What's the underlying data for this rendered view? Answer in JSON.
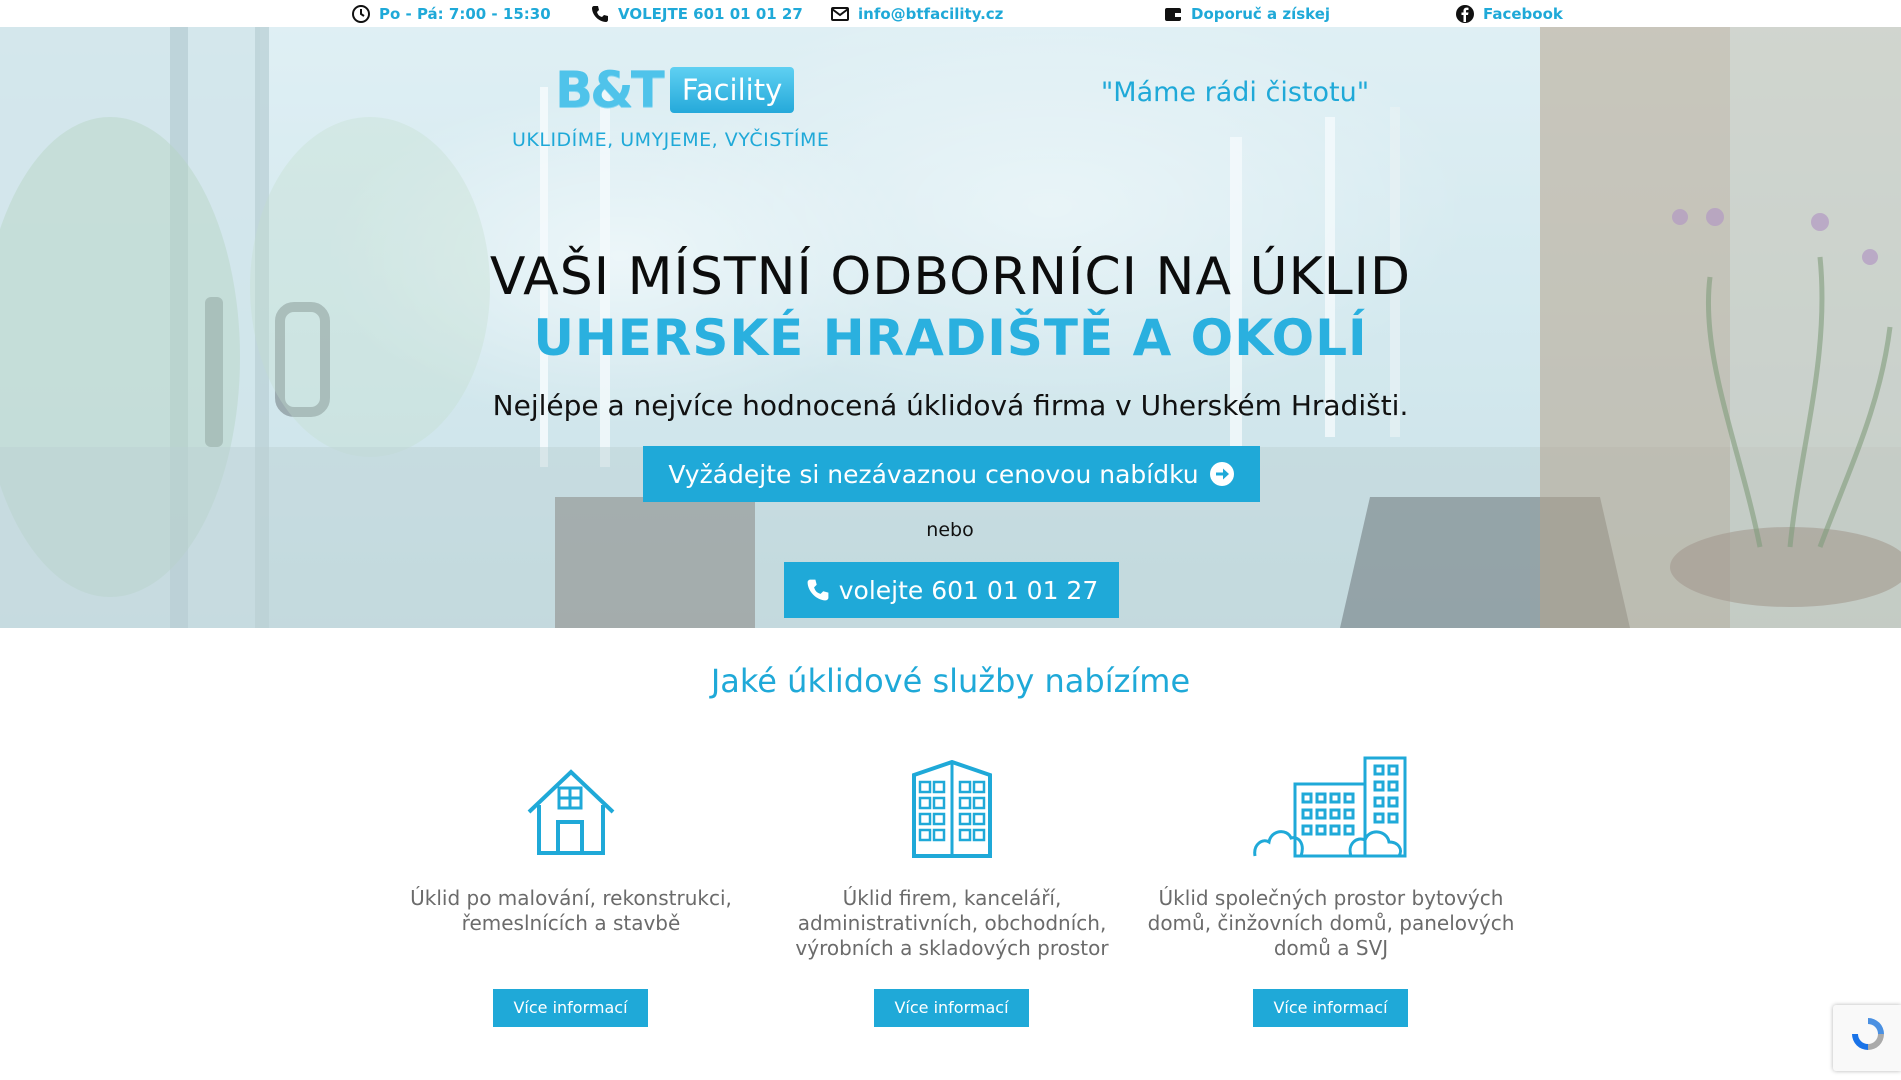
{
  "topbar": {
    "hours": "Po - Pá: 7:00 - 15:30",
    "phone": "VOLEJTE 601 01 01 27",
    "email": "info@btfacility.cz",
    "recommend": "Doporuč a získej",
    "facebook": "Facebook"
  },
  "brand": {
    "logo_bt": "B&T",
    "logo_facility": "Facility",
    "tagline": "UKLIDÍME, UMYJEME, VYČISTÍME",
    "motto": "\"Máme rádi čistotu\""
  },
  "hero": {
    "headline": "VAŠI MÍSTNÍ ODBORNÍCI NA ÚKLID",
    "headline_accent": "UHERSKÉ HRADIŠTĚ A OKOLÍ",
    "subline": "Nejlépe a nejvíce hodnocená úklidová firma v Uherském Hradišti.",
    "cta_quote": "Vyžádejte si nezávaznou cenovou nabídku",
    "or_text": "nebo",
    "cta_call": "volejte 601 01 01 27"
  },
  "services": {
    "title": "Jaké úklidové služby nabízíme",
    "items": [
      {
        "text": "Úklid po malování, rekonstrukci, řemeslnících a stavbě",
        "button": "Více informací",
        "icon": "house-icon"
      },
      {
        "text": "Úklid firem, kanceláří, administrativních, obchodních, výrobních a skladových prostor",
        "button": "Více informací",
        "icon": "office-building-icon"
      },
      {
        "text": "Úklid společných prostor bytových domů, činžovních domů, panelových domů a SVJ",
        "button": "Více informací",
        "icon": "apartment-buildings-icon"
      }
    ]
  },
  "colors": {
    "accent": "#1fa9d8",
    "text_dark": "#111111",
    "text_muted": "#6b6b6b"
  }
}
